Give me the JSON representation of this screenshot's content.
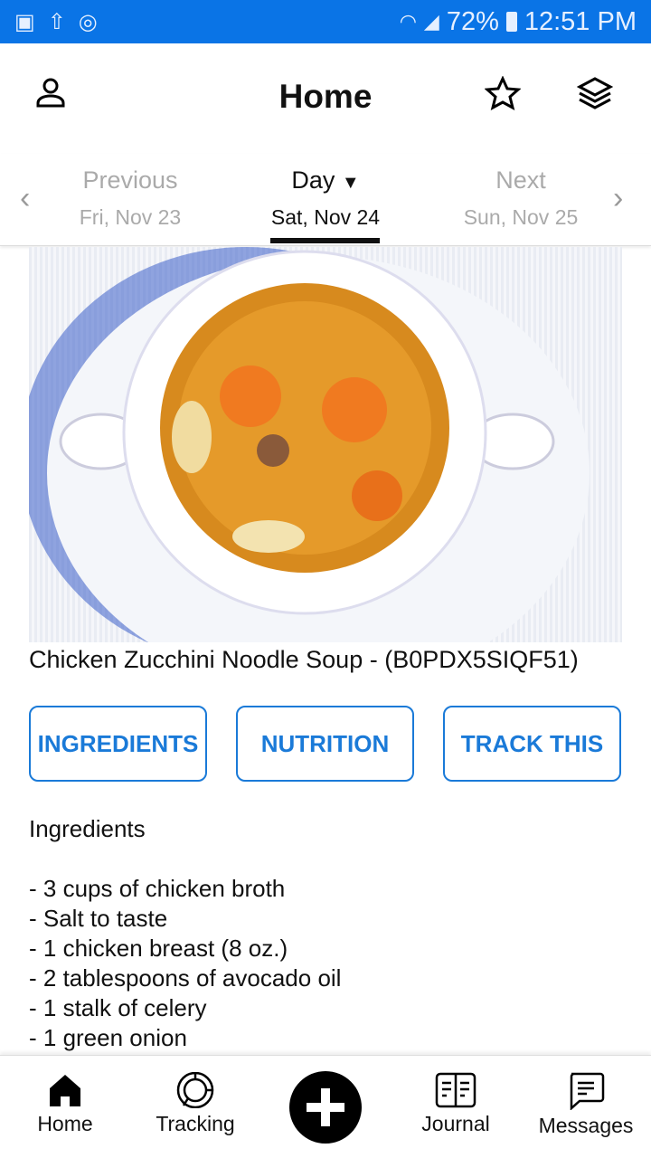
{
  "status": {
    "battery": "72%",
    "time": "12:51 PM"
  },
  "header": {
    "title": "Home"
  },
  "datenav": {
    "previous": {
      "label": "Previous",
      "date": "Fri, Nov 23"
    },
    "current": {
      "label": "Day",
      "date": "Sat, Nov 24"
    },
    "next": {
      "label": "Next",
      "date": "Sun, Nov 25"
    }
  },
  "recipe": {
    "title": "Chicken Zucchini Noodle Soup - (B0PDX5SIQF51)"
  },
  "buttons": {
    "ingredients": "INGREDIENTS",
    "nutrition": "NUTRITION",
    "track": "TRACK THIS"
  },
  "ingredients": {
    "heading": "Ingredients",
    "items": [
      "- 3 cups of chicken broth",
      "- Salt to taste",
      "- 1 chicken breast (8 oz.)",
      "- 2 tablespoons of avocado oil",
      "- 1 stalk of celery",
      "- 1 green onion"
    ]
  },
  "tabs": {
    "home": "Home",
    "tracking": "Tracking",
    "journal": "Journal",
    "messages": "Messages"
  },
  "colors": {
    "status_bar": "#0a74e6",
    "accent": "#1a7ad8"
  }
}
